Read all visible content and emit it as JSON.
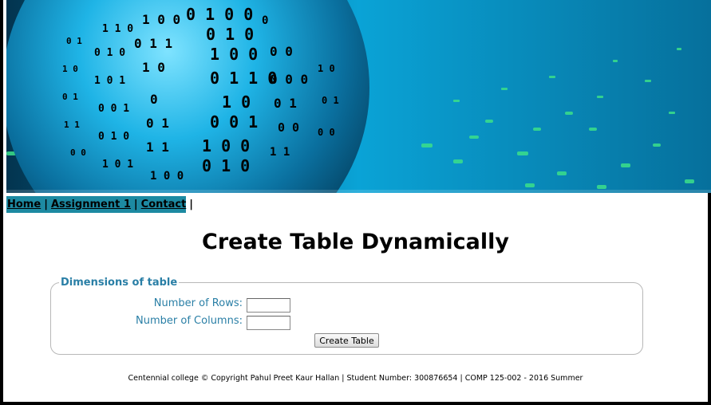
{
  "nav": {
    "home": "Home",
    "assignment": "Assignment 1",
    "contact": "Contact",
    "separator": "|"
  },
  "page": {
    "title": "Create Table Dynamically"
  },
  "form": {
    "legend": "Dimensions of table",
    "rows_label": "Number of Rows:",
    "rows_value": "",
    "columns_label": "Number of Columns:",
    "columns_value": "",
    "submit_label": "Create Table"
  },
  "footer": {
    "text": "Centennial college © Copyright Pahul Preet Kaur Hallan | Student Number: 300876654 | COMP 125-002 - 2016 Summer"
  },
  "colors": {
    "nav_bg": "#1d8aa2",
    "label": "#2a7fa6"
  }
}
